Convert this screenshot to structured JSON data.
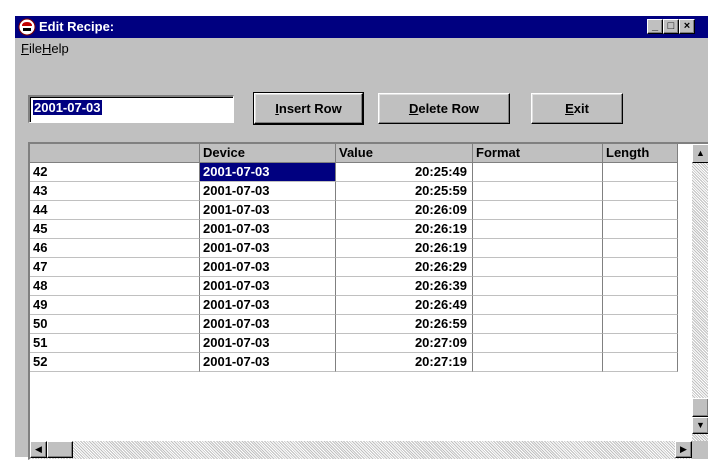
{
  "window": {
    "title": "Edit Recipe:",
    "controls": {
      "minimize": "_",
      "maximize": "□",
      "close": "×"
    }
  },
  "menu": [
    {
      "label": "File",
      "mnemonic": "F",
      "rest": "ile"
    },
    {
      "label": "Help",
      "mnemonic": "H",
      "rest": "elp"
    }
  ],
  "date_input": {
    "value": "2001-07-03"
  },
  "toolbar": {
    "insert_row": {
      "label": "Insert Row",
      "mnemonic": "I",
      "rest": "nsert Row"
    },
    "delete_row": {
      "label": "Delete Row",
      "mnemonic": "D",
      "rest": "elete Row"
    },
    "exit": {
      "label": "Exit",
      "mnemonic": "E",
      "rest": "xit"
    }
  },
  "table": {
    "columns": [
      "",
      "Device",
      "Value",
      "Format",
      "Length"
    ],
    "rows": [
      [
        "42",
        "2001-07-03",
        "20:25:49",
        "",
        ""
      ],
      [
        "43",
        "2001-07-03",
        "20:25:59",
        "",
        ""
      ],
      [
        "44",
        "2001-07-03",
        "20:26:09",
        "",
        ""
      ],
      [
        "45",
        "2001-07-03",
        "20:26:19",
        "",
        ""
      ],
      [
        "46",
        "2001-07-03",
        "20:26:19",
        "",
        ""
      ],
      [
        "47",
        "2001-07-03",
        "20:26:29",
        "",
        ""
      ],
      [
        "48",
        "2001-07-03",
        "20:26:39",
        "",
        ""
      ],
      [
        "49",
        "2001-07-03",
        "20:26:49",
        "",
        ""
      ],
      [
        "50",
        "2001-07-03",
        "20:26:59",
        "",
        ""
      ],
      [
        "51",
        "2001-07-03",
        "20:27:09",
        "",
        ""
      ],
      [
        "52",
        "2001-07-03",
        "20:27:19",
        "",
        ""
      ]
    ],
    "selected_row": 0,
    "selected_col": 1
  },
  "colors": {
    "titlebar": "#000080",
    "face": "#c0c0c0",
    "selection": "#000080"
  },
  "icons": {
    "app": "chef-hat-icon",
    "scroll_up": "arrow-up-icon",
    "scroll_down": "arrow-down-icon",
    "scroll_left": "arrow-left-icon",
    "scroll_right": "arrow-right-icon"
  }
}
